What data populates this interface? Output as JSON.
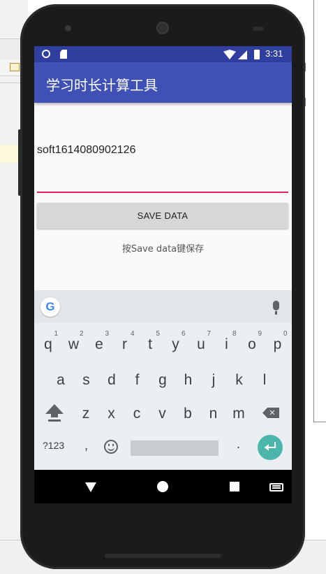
{
  "status_bar": {
    "time": "3:31"
  },
  "app_bar": {
    "title": "学习时长计算工具"
  },
  "content": {
    "edit_text_value": "soft1614080902126",
    "save_button_label": "SAVE DATA",
    "hint_text": "按Save data键保存"
  },
  "keyboard": {
    "row1": [
      {
        "letter": "q",
        "num": "1"
      },
      {
        "letter": "w",
        "num": "2"
      },
      {
        "letter": "e",
        "num": "3"
      },
      {
        "letter": "r",
        "num": "4"
      },
      {
        "letter": "t",
        "num": "5"
      },
      {
        "letter": "y",
        "num": "6"
      },
      {
        "letter": "u",
        "num": "7"
      },
      {
        "letter": "i",
        "num": "8"
      },
      {
        "letter": "o",
        "num": "9"
      },
      {
        "letter": "p",
        "num": "0"
      }
    ],
    "row2": [
      "a",
      "s",
      "d",
      "f",
      "g",
      "h",
      "j",
      "k",
      "l"
    ],
    "row3": [
      "z",
      "x",
      "c",
      "v",
      "b",
      "n",
      "m"
    ],
    "symbols_label": "?123",
    "comma_label": ",",
    "period_label": ".",
    "google_logo_letter": "G"
  },
  "colors": {
    "status_bar": "#303f9f",
    "app_bar": "#3f51b5",
    "accent": "#e91e63",
    "enter_key": "#4db6ac"
  },
  "icons": [
    "google-logo-icon",
    "mic-icon",
    "shift-icon",
    "backspace-icon",
    "emoji-icon",
    "enter-icon",
    "nav-back-icon",
    "nav-home-icon",
    "nav-recents-icon",
    "nav-keyboard-icon"
  ]
}
